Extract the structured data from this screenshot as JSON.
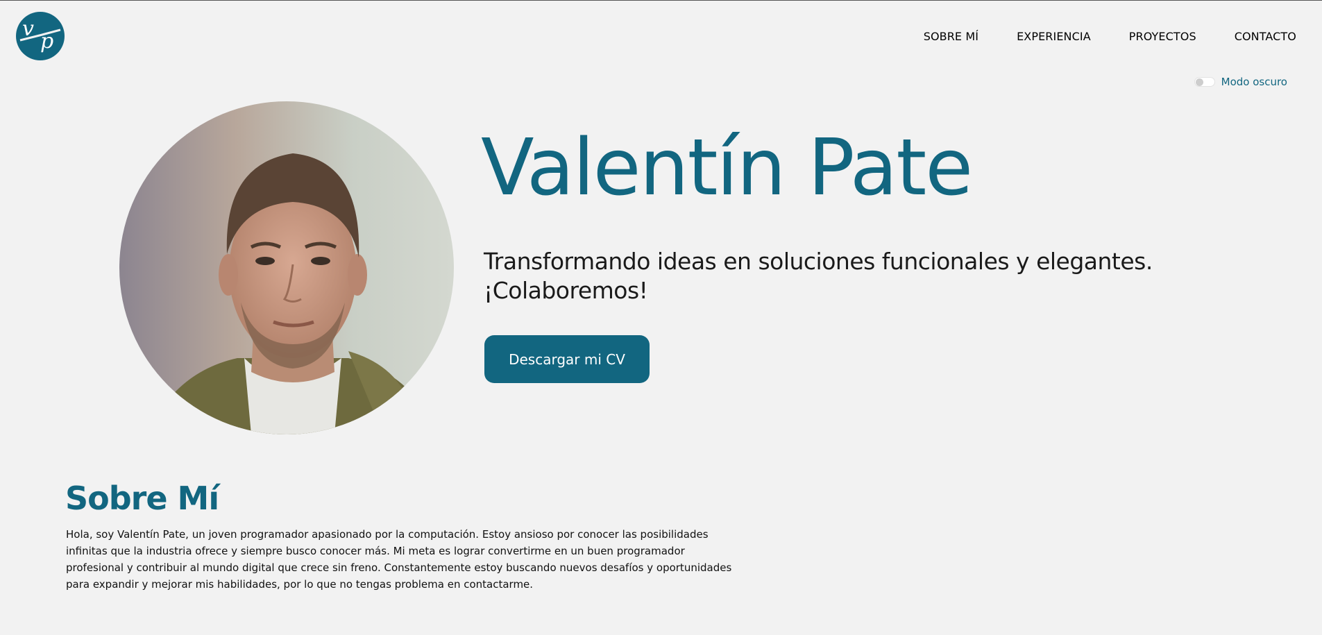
{
  "logo": {
    "letters": "vp",
    "color": "#126680"
  },
  "nav": {
    "items": [
      {
        "label": "SOBRE MÍ"
      },
      {
        "label": "EXPERIENCIA"
      },
      {
        "label": "PROYECTOS"
      },
      {
        "label": "CONTACTO"
      }
    ]
  },
  "theme_toggle": {
    "label": "Modo oscuro",
    "enabled": false
  },
  "hero": {
    "name": "Valentín Pate",
    "tagline": "Transformando ideas en soluciones funcionales y elegantes. ¡Colaboremos!",
    "cta_label": "Descargar mi CV"
  },
  "about": {
    "title": "Sobre Mí",
    "text": "Hola, soy Valentín Pate, un joven programador apasionado por la computación. Estoy ansioso por conocer las posibilidades infinitas que la industria ofrece y siempre busco conocer más. Mi meta es lograr convertirme en un buen programador profesional y contribuir al mundo digital que crece sin freno. Constantemente estoy buscando nuevos desafíos y oportunidades para expandir y mejorar mis habilidades, por lo que no tengas problema en contactarme."
  },
  "colors": {
    "accent": "#126680",
    "background": "#f2f2f2"
  }
}
